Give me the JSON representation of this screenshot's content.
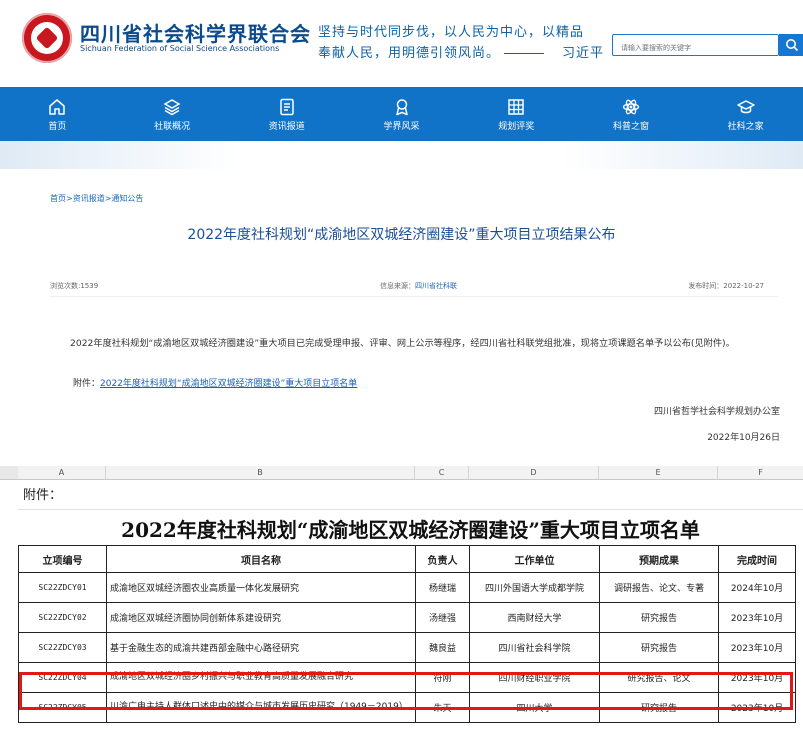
{
  "header": {
    "site_name": "四川省社会科学界联合会",
    "site_name_en": "Sichuan Federation of Social Science Associations",
    "quote_line1": "坚持与时代同步伐，以人民为中心，以精品",
    "quote_line2": "奉献人民，用明德引领风尚。",
    "quote_author": "习近平",
    "search_placeholder": "请输入要搜索的关键字",
    "search_icon": "search-icon"
  },
  "nav": {
    "items": [
      {
        "label": "首页",
        "icon": "home-icon"
      },
      {
        "label": "社联概况",
        "icon": "layers-icon"
      },
      {
        "label": "资讯报道",
        "icon": "document-icon"
      },
      {
        "label": "学界风采",
        "icon": "award-icon"
      },
      {
        "label": "规划评奖",
        "icon": "calendar-grid-icon"
      },
      {
        "label": "科普之窗",
        "icon": "atom-icon"
      },
      {
        "label": "社科之家",
        "icon": "graduation-cap-icon"
      }
    ]
  },
  "article": {
    "breadcrumb": "首页>资讯报道>通知公告",
    "title": "2022年度社科规划“成渝地区双城经济圈建设”重大项目立项结果公布",
    "views_label": "浏览次数:1539",
    "source_label": "信息来源：",
    "source": "四川省社科联",
    "publish_label": "发布时间：2022-10-27",
    "body": "2022年度社科规划“成渝地区双城经济圈建设”重大项目已完成受理申报、评审、网上公示等程序，经四川省社科联党组批准，现将立项课题名单予以公布(见附件)。",
    "attach_prefix": "附件：",
    "attach_link": "2022年度社科规划“成渝地区双城经济圈建设”重大项目立项名单",
    "signature_office": "四川省哲学社会科学规划办公室",
    "signature_date": "2022年10月26日"
  },
  "sheet": {
    "col_letters": [
      "A",
      "B",
      "C",
      "D",
      "E",
      "F"
    ],
    "attach_label": "附件：",
    "title": "2022年度社科规划“成渝地区双城经济圈建设”重大项目立项名单",
    "headers": [
      "立项编号",
      "项目名称",
      "负责人",
      "工作单位",
      "预期成果",
      "完成时间"
    ],
    "rows": [
      [
        "SC22ZDCY01",
        "成渝地区双城经济圈农业高质量一体化发展研究",
        "杨继瑞",
        "四川外国语大学成都学院",
        "调研报告、论文、专著",
        "2024年10月"
      ],
      [
        "SC22ZDCY02",
        "成渝地区双城经济圈协同创新体系建设研究",
        "汤继强",
        "西南财经大学",
        "研究报告",
        "2023年10月"
      ],
      [
        "SC22ZDCY03",
        "基于金融生态的成渝共建西部金融中心路径研究",
        "魏良益",
        "四川省社会科学院",
        "研究报告",
        "2023年10月"
      ],
      [
        "SC22ZDCY04",
        "成渝地区双城经济圈乡村振兴与职业教育高质量发展融合研究",
        "符刚",
        "四川财经职业学院",
        "研究报告、论文",
        "2023年10月"
      ],
      [
        "SC22ZDCY05",
        "川渝广电主持人群体口述史中的媒介与城市发展历史研究（1949－2019）",
        "朱天",
        "四川大学",
        "研究报告",
        "2023年10月"
      ]
    ],
    "highlighted_row": 4,
    "highlight_color": "#e01818"
  },
  "colors": {
    "nav_blue": "#1173c8",
    "title_blue": "#1a4f9a",
    "logo_red": "#c8171e"
  }
}
